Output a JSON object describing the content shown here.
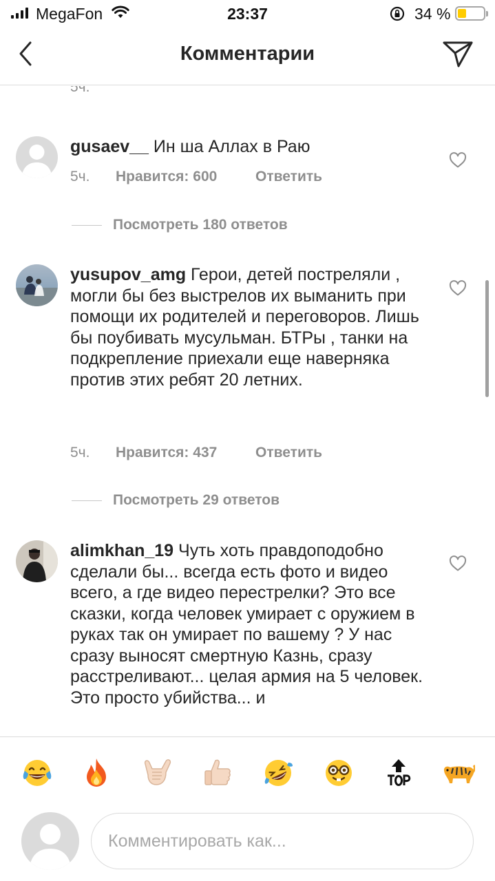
{
  "status_bar": {
    "carrier": "MegaFon",
    "time": "23:37",
    "battery_percent": "34 %",
    "battery_level": 0.34
  },
  "nav": {
    "title": "Комментарии",
    "back_icon": "chevron-left-icon",
    "send_icon": "paper-plane-icon"
  },
  "top_partial_time": "5ч.",
  "comments": [
    {
      "username": "gusaev__",
      "text": " Ин ша Аллах в Раю",
      "time": "5ч.",
      "likes": "Нравится: 600",
      "reply": "Ответить",
      "view_replies": "Посмотреть 180 ответов"
    },
    {
      "username": "yusupov_amg",
      "text": " Герои, детей постреляли , могли бы без выстрелов их выманить при помощи их родителей и переговоров. Лишь бы поубивать мусульман. БТРы , танки на подкрепление приехали еще наверняка против этих ребят 20 летних.",
      "time": "5ч.",
      "likes": "Нравится: 437",
      "reply": "Ответить",
      "view_replies": "Посмотреть 29 ответов"
    },
    {
      "username": "alimkhan_19",
      "text": " Чуть хоть правдоподобно сделали бы... всегда есть фото и видео всего, а где видео перестрелки? Это все сказки, когда человек умирает с оружием в руках так он умирает по вашему ? У нас сразу выносят смертную Казнь, сразу расстреливают... целая армия на 5 человек. Это просто убийства... и"
    }
  ],
  "emoji_bar": [
    "😂",
    "🔥",
    "🤙🏻",
    "👍🏻",
    "🤣",
    "🤓",
    "🔝",
    "🐅"
  ],
  "input": {
    "placeholder": "Комментировать как..."
  },
  "colors": {
    "text": "#262626",
    "secondary": "#8e8e8e",
    "divider": "#dbdbdb",
    "battery_fill": "#ffcc00"
  }
}
